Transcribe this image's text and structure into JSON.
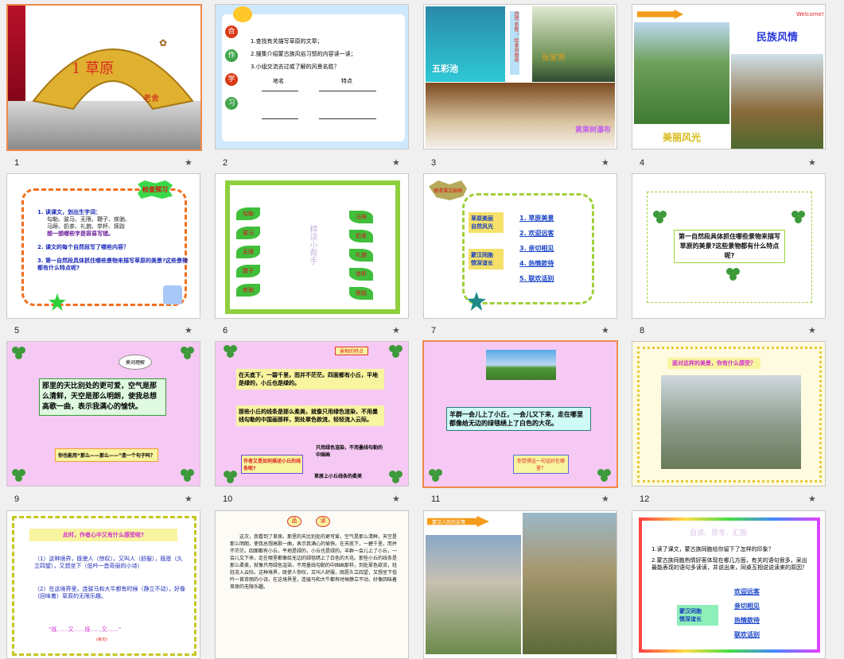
{
  "slides": [
    {
      "num": "1",
      "title": "1 草原",
      "author": "老舍"
    },
    {
      "num": "2",
      "side": [
        "合",
        "作",
        "学",
        "习"
      ],
      "lines": [
        "1.查找有关描写草原的文章；",
        "2.搜集介绍蒙古族风俗习惯的内容读一读；",
        "3.小组交流去过或了解的风景名胜？"
      ],
      "col1": "地名",
      "col2": "特点"
    },
    {
      "num": "3",
      "labels": [
        "五彩池",
        "张家界",
        "黄果树瀑布"
      ],
      "vertical": "自然 名胜 ，绘本自由选"
    },
    {
      "num": "4",
      "title": "民族风情",
      "caption": "美丽风光",
      "welcome": "Welcome!"
    },
    {
      "num": "5",
      "badge": "检查预习",
      "items": [
        "1. 读课文，划出生字词：",
        "勾勒、骏马、无限、鞭子、疾驰、",
        "马蹄、奶茶、礼貌、举杯、摔跤",
        "想一想哪些字是容易写错。",
        "2. 课文的每个自然段写了哪些内容？",
        "3. 第一自然段具体抓住哪些景物来描写草原的美景?这些景物都有什么特点呢?"
      ]
    },
    {
      "num": "6",
      "center": "精读小帮手",
      "leaves_left": [
        "勾勒",
        "骏马",
        "无限",
        "鞭子",
        "疾驰"
      ],
      "leaves_right": [
        "马蹄",
        "奶茶",
        "礼貌",
        "举杯",
        "摔跤"
      ]
    },
    {
      "num": "7",
      "tag": "理清课文脉络",
      "left1": "草原美丽\n自然风光",
      "left2": "蒙汉同胞\n情深谊长",
      "items": [
        "1. 草原美景",
        "2. 欢迎远客",
        "3. 亲切相见",
        "4. 热情款待",
        "5. 联欢话别"
      ]
    },
    {
      "num": "8",
      "text": "第一自然段具体抓住哪些景物来描写草原的美景?这些景物都有什么特点呢?"
    },
    {
      "num": "9",
      "bubble": "换词理解",
      "text": "那里的天比别处的更可爱，空气是那么清鲜，天空是那么明朗，使我总想高歌一曲，表示我满心的愉快。",
      "question": "你也能用“那么——那么——”造一个句子吗？"
    },
    {
      "num": "10",
      "tag": "景物的特点",
      "para1": "在天底下，一碧千里，而并不茫茫。四面都有小丘，平地是绿的，小丘也是绿的。",
      "para2": "那些小丘的线条是那么柔美，就像只用绿色渲染，不用墨线勾勒的中国画那样，到处翠色欲流，轻轻流入云际。",
      "q": "作者又是如何描述小丘的线条呢?",
      "note": "只用绿色渲染，不用墨线勾勒的中国画",
      "foot": "草原上小丘线条的柔美"
    },
    {
      "num": "11",
      "text": "羊群一会儿上了小丘，一会儿又下来，走在哪里都像给无边的绿毯绣上了白色的大花。",
      "q": "你觉得这一句话好在哪里？"
    },
    {
      "num": "12",
      "q": "面对这样的美景，你有什么感受？"
    },
    {
      "num": "13",
      "q": "此时，作者心中又有什么感受呢?",
      "p1": "（1）这种境界，既使人（惊叹），又叫人（舒服），既愿（久立四望），又想坐下（低吟一首奇丽的小诗）",
      "p2": "（2）在这境界里，连骏马和大牛都有时候（静立不动），好像（回味着）草原的无限乐趣。",
      "pattern": "“既……又……既……又……”",
      "tip": "(练句)"
    },
    {
      "num": "14",
      "circles": [
        "品",
        "读"
      ],
      "body": "这次，我看到了草原。那里的天比别处的更可爱，空气是那么清鲜，天空是那么明朗，使我总想高歌一曲，表示我满心的愉快。在天底下，一碧千里，而并不茫茫。四面都有小丘，平地是绿的，小丘也是绿的。羊群一会儿上了小丘，一会儿又下来，走在哪里都像给无边的绿毯绣上了白色的大花。那些小丘的线条是那么柔美，就像只用绿色渲染，不用墨线勾勒的中国画那样，到处翠色欲流，轻轻流入云际。这种境界，既使人惊叹，又叫人舒服，既愿久立四望，又想坐下低吟一首奇丽的小诗。在这境界里，连骏马和大牛都有时候静立不动，好像回味着草原的无限乐趣。"
    },
    {
      "num": "15",
      "tag": "蒙汉人民的友情"
    },
    {
      "num": "16",
      "title": "自读、思考、汇报",
      "q1": "1.读了课文，蒙古族同胞给你留下了怎样的印象？",
      "q2": "2.蒙古族同胞热情好客体现在哪几方面，有关的语句很多，采出最能表现的语句多读读，并说出来，同桌互相说说读来的原因？",
      "left": "蒙汉同胞\n情深谊长",
      "items": [
        "欢迎远客",
        "亲切相见",
        "热情款待",
        "联欢话别"
      ]
    }
  ],
  "colors": {
    "selected": "#f08a4b",
    "pink": "#f6c9f4",
    "green": "#3d9a3a"
  }
}
